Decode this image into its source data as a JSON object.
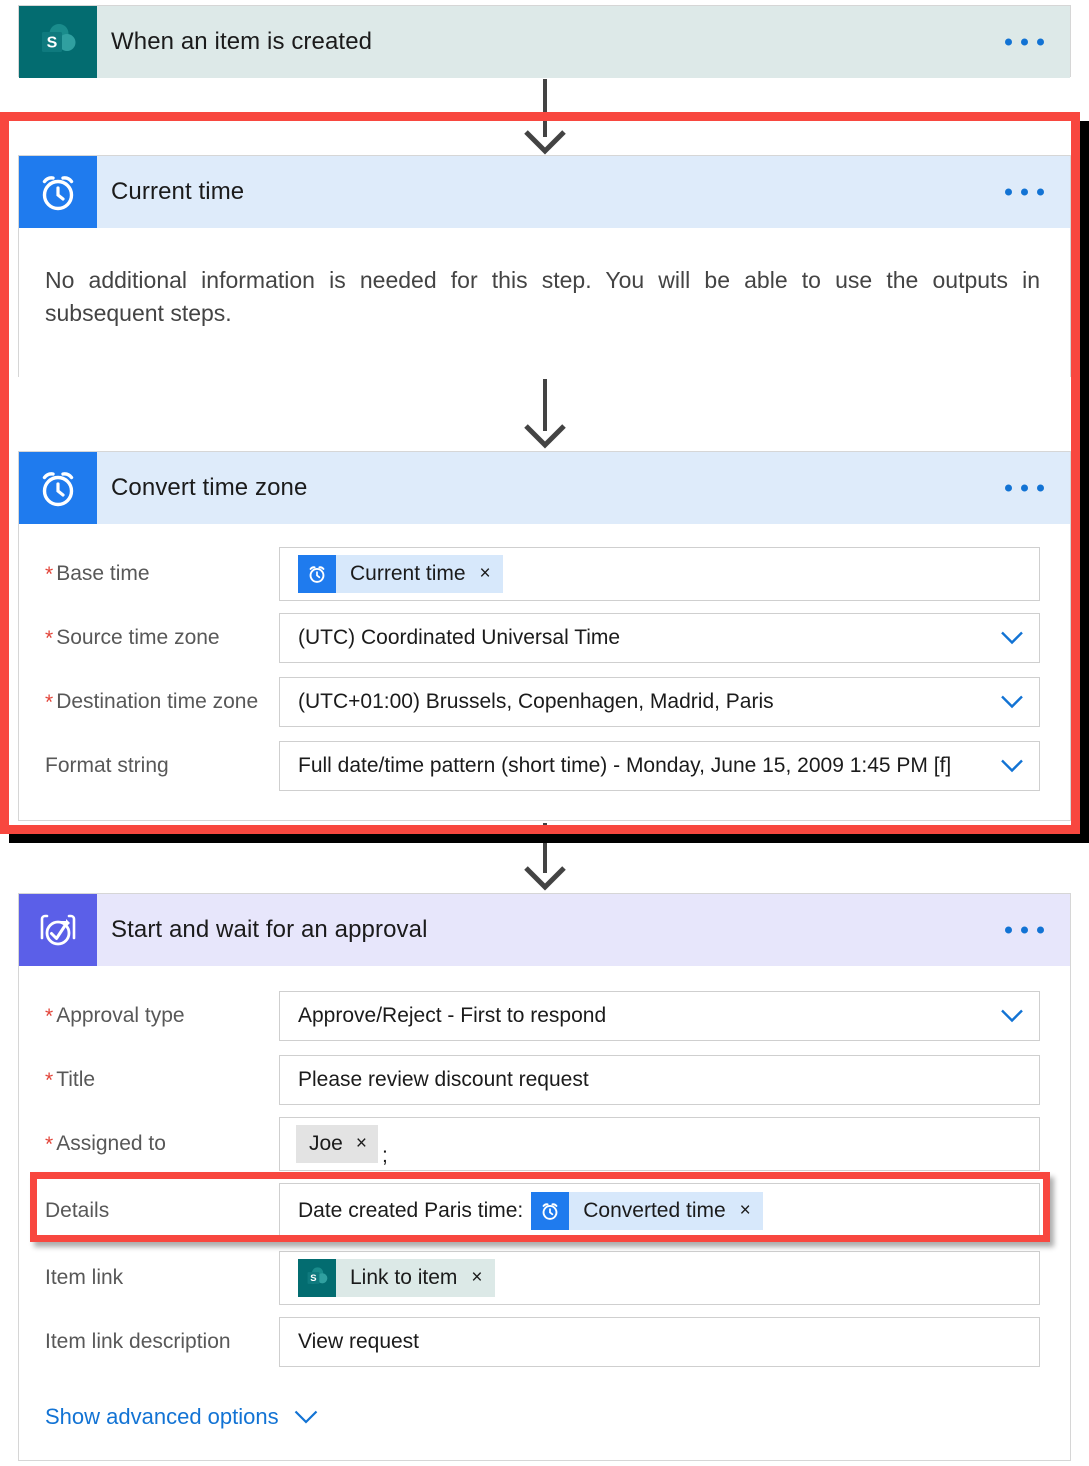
{
  "flow": {
    "steps": [
      {
        "id": "trigger",
        "title": "When an item is created",
        "icon": "sharepoint-icon",
        "menu": "more-options"
      },
      {
        "id": "current-time",
        "title": "Current time",
        "icon": "alarm-clock-icon",
        "menu": "more-options",
        "info": "No additional information is needed for this step. You will be able to use the outputs in subsequent steps."
      },
      {
        "id": "convert-time-zone",
        "title": "Convert time zone",
        "icon": "alarm-clock-icon",
        "menu": "more-options"
      },
      {
        "id": "start-and-wait-approval",
        "title": "Start and wait for an approval",
        "icon": "approval-icon",
        "menu": "more-options"
      }
    ]
  },
  "convert_time_zone": {
    "fields": {
      "base_time": {
        "label": "Base time",
        "required": true,
        "token": {
          "text": "Current time",
          "remove": "×",
          "icon": "alarm-clock-icon"
        }
      },
      "source_time_zone": {
        "label": "Source time zone",
        "required": true,
        "value": "(UTC) Coordinated Universal Time",
        "chevron": "chevron-down-icon"
      },
      "destination_time_zone": {
        "label": "Destination time zone",
        "required": true,
        "value": "(UTC+01:00) Brussels, Copenhagen, Madrid, Paris",
        "chevron": "chevron-down-icon"
      },
      "format_string": {
        "label": "Format string",
        "required": false,
        "value": "Full date/time pattern (short time) - Monday, June 15, 2009 1:45 PM [f]",
        "chevron": "chevron-down-icon"
      }
    }
  },
  "approval": {
    "fields": {
      "approval_type": {
        "label": "Approval type",
        "required": true,
        "value": "Approve/Reject - First to respond",
        "chevron": "chevron-down-icon"
      },
      "title": {
        "label": "Title",
        "required": true,
        "value": "Please review discount request"
      },
      "assigned_to": {
        "label": "Assigned to",
        "required": true,
        "pill": {
          "text": "Joe",
          "remove": "×"
        },
        "separator": ";"
      },
      "details": {
        "label": "Details",
        "required": false,
        "prefix": "Date created Paris time:",
        "token": {
          "text": "Converted time",
          "remove": "×",
          "icon": "alarm-clock-icon"
        }
      },
      "item_link": {
        "label": "Item link",
        "required": false,
        "token": {
          "text": "Link to item",
          "remove": "×",
          "icon": "sharepoint-icon"
        }
      },
      "item_link_description": {
        "label": "Item link description",
        "required": false,
        "value": "View request"
      }
    },
    "advanced_options": {
      "label": "Show advanced options",
      "chevron": "chevron-down-icon"
    }
  },
  "colors": {
    "sharepoint_teal": "#036c70",
    "connector_blue": "#1f7bee",
    "approval_purple": "#5b5fe8",
    "highlight_red": "#f8473f",
    "link_blue": "#1273d4",
    "required_star": "#e2453a"
  }
}
